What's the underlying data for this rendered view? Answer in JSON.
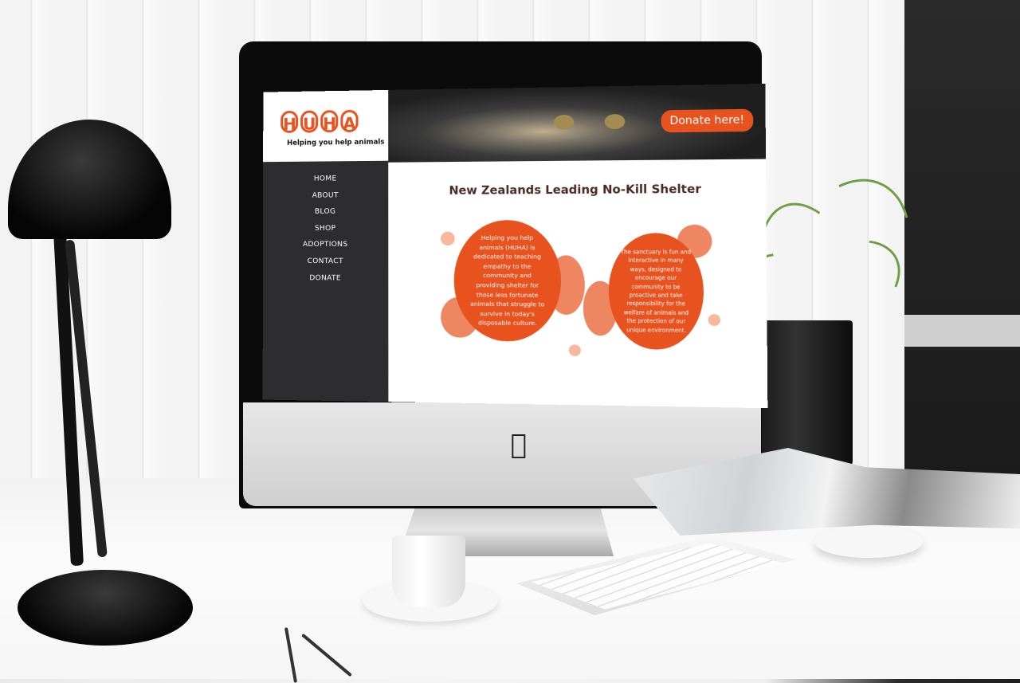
{
  "site": {
    "logo_letters": [
      "H",
      "U",
      "H",
      "A"
    ],
    "tagline": "Helping you help animals",
    "nav": [
      "HOME",
      "ABOUT",
      "BLOG",
      "SHOP",
      "ADOPTIONS",
      "CONTACT",
      "DONATE"
    ],
    "donate_button": "Donate here!",
    "headline": "New Zealands Leading No-Kill Shelter",
    "circle_left": "Helping you help animals (HUHA) is dedicated to teaching empathy to the community and providing shelter for those less fortunate animals that struggle to survive in today's disposable culture.",
    "circle_right": "The sanctuary is fun and interactive in many ways, designed to encourage our community to be proactive and take responsibility for the welfare of animals and the protection of our unique environment."
  },
  "colors": {
    "accent": "#e8521f",
    "accent_mid": "#ee8662",
    "accent_light": "#f6b79d",
    "sidebar": "#2d2d2f"
  }
}
